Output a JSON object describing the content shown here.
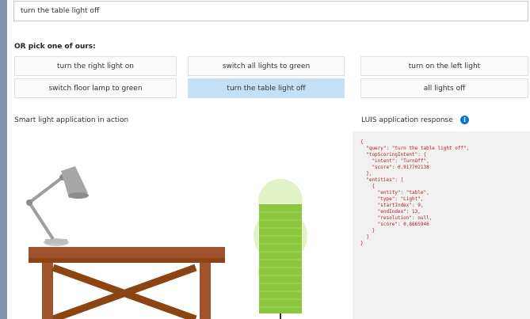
{
  "query": {
    "value": "turn the table light off"
  },
  "suggestions": {
    "heading": "OR pick one of ours:",
    "buttons": [
      "turn the right light on",
      "switch all lights to green",
      "turn on the left light",
      "switch floor lamp to green",
      "turn the table light off",
      "all lights off"
    ],
    "selected_index": 4
  },
  "app_section": {
    "label": "Smart light application in action"
  },
  "response_section": {
    "label": "LUIS application response",
    "info_icon": "i",
    "json_lines": [
      "{",
      "  \"query\": \"turn the table light off\",",
      "  \"topScoringIntent\": {",
      "    \"intent\": \"TurnOff\",",
      "    \"score\": 0.917702138",
      "  },",
      "  \"entities\": [",
      "    {",
      "      \"entity\": \"table\",",
      "      \"type\": \"Light\",",
      "      \"startIndex\": 9,",
      "      \"endIndex\": 13,",
      "      \"resolution\": null,",
      "      \"score\": 0.8665946",
      "    }",
      "  ]",
      "}"
    ]
  },
  "colors": {
    "selected_button": "#c5e0f5",
    "floor_lamp_green": "#8cc63f",
    "table_wood": "#a0522d"
  }
}
